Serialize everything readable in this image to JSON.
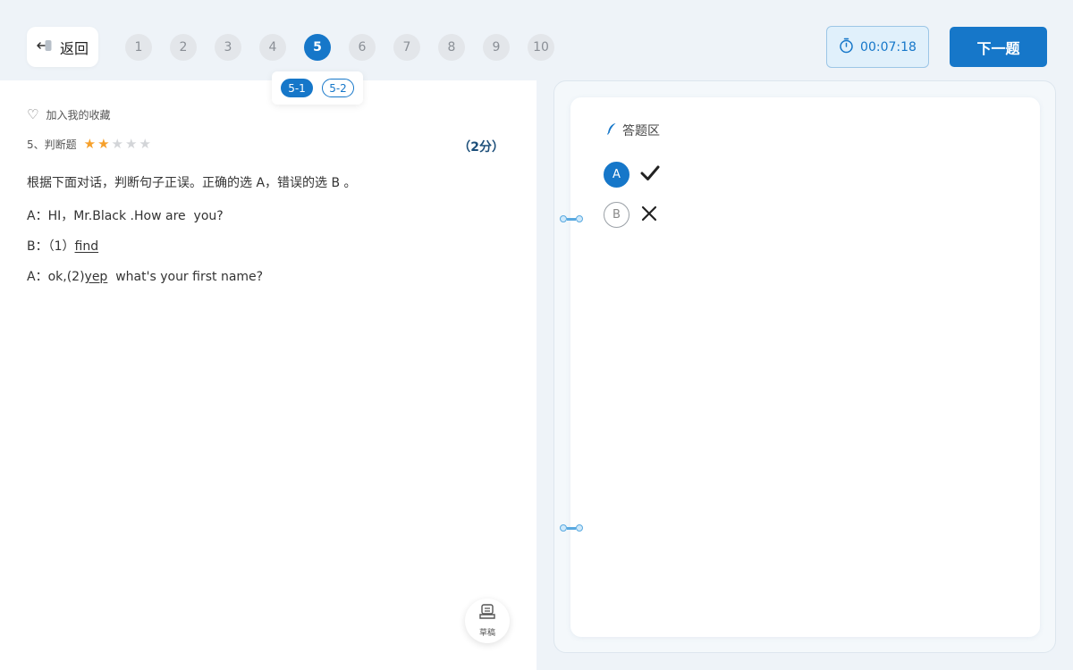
{
  "header": {
    "back_label": "返回",
    "question_numbers": [
      "1",
      "2",
      "3",
      "4",
      "5",
      "6",
      "7",
      "8",
      "9",
      "10"
    ],
    "current_question": "5",
    "sub_questions": [
      "5-1",
      "5-2"
    ],
    "current_sub_question": "5-1",
    "timer": "00:07:18",
    "next_label": "下一题"
  },
  "question": {
    "favorite_label": "加入我的收藏",
    "type_label": "5、判断题",
    "difficulty": {
      "filled": 2,
      "total": 5
    },
    "score": "（2分）",
    "prompt": "根据下面对话，判断句子正误。正确的选 A，错误的选 B 。",
    "dialogue": {
      "line1": "A：HI，Mr.Black .How are  you?",
      "line2_prefix": "B：（1）",
      "line2_blank": "find",
      "line3_prefix": "A：ok,(2)",
      "line3_blank": "yep",
      "line3_suffix": "  what's your first name?"
    },
    "draft_label": "草稿"
  },
  "answer": {
    "title": "答题区",
    "options": [
      {
        "letter": "A",
        "meaning": "correct",
        "selected": true
      },
      {
        "letter": "B",
        "meaning": "wrong",
        "selected": false
      }
    ]
  },
  "colors": {
    "accent": "#1677c9",
    "star_on": "#f6a02b",
    "star_off": "#d3d5d8",
    "timer_bg": "#e0f0fb"
  }
}
